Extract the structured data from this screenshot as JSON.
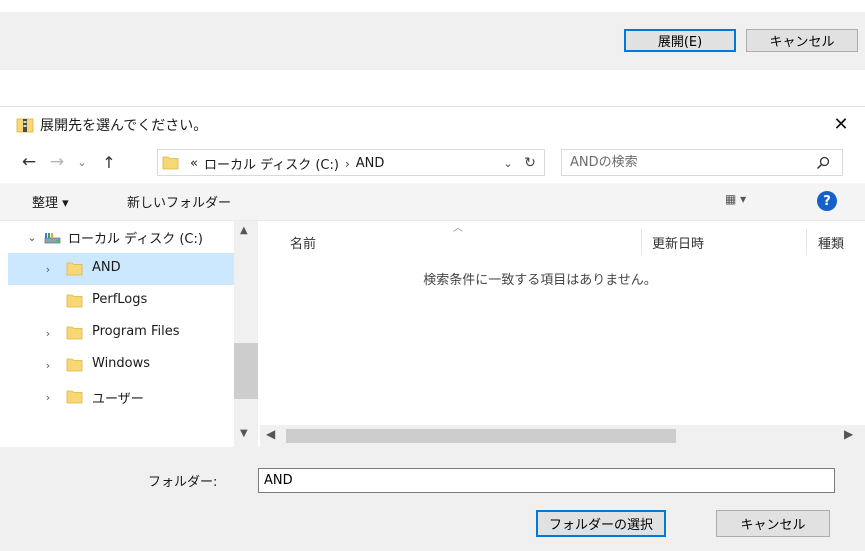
{
  "background": {
    "expand_button": "展開(E)",
    "cancel_button": "キャンセル"
  },
  "dialog": {
    "title": "展開先を選んでください。",
    "close": "✕",
    "nav": {
      "back": "←",
      "forward": "→",
      "recent": "⌄",
      "up": "↑"
    },
    "address": {
      "overflow": "«",
      "segments": [
        "ローカル ディスク (C:)",
        "AND"
      ],
      "separator": "›",
      "dropdown": "⌄",
      "refresh": "↻"
    },
    "search": {
      "placeholder": "ANDの検索",
      "value": ""
    },
    "commands": {
      "organize": "整理 ▾",
      "new_folder": "新しいフォルダー",
      "view": "▦ ▾",
      "help": "?"
    },
    "tree": [
      {
        "label": "ローカル ディスク (C:)",
        "chevron": "⌄",
        "icon": "drive-icon",
        "indent": 0,
        "selected": false
      },
      {
        "label": "AND",
        "chevron": "›",
        "icon": "folder-icon",
        "indent": 1,
        "selected": true
      },
      {
        "label": "PerfLogs",
        "chevron": "",
        "icon": "folder-icon",
        "indent": 1,
        "selected": false
      },
      {
        "label": "Program Files",
        "chevron": "›",
        "icon": "folder-icon",
        "indent": 1,
        "selected": false
      },
      {
        "label": "Windows",
        "chevron": "›",
        "icon": "folder-icon",
        "indent": 1,
        "selected": false
      },
      {
        "label": "ユーザー",
        "chevron": "›",
        "icon": "folder-icon",
        "indent": 1,
        "selected": false
      }
    ],
    "columns": [
      "名前",
      "更新日時",
      "種類"
    ],
    "empty_message": "検索条件に一致する項目はありません。",
    "folder_label": "フォルダー:",
    "folder_value": "AND",
    "select_folder_button": "フォルダーの選択",
    "cancel_button": "キャンセル"
  },
  "colors": {
    "accent": "#0078d7",
    "selection": "#cce8ff",
    "folder": "#f8d775",
    "help": "#1560c9"
  }
}
